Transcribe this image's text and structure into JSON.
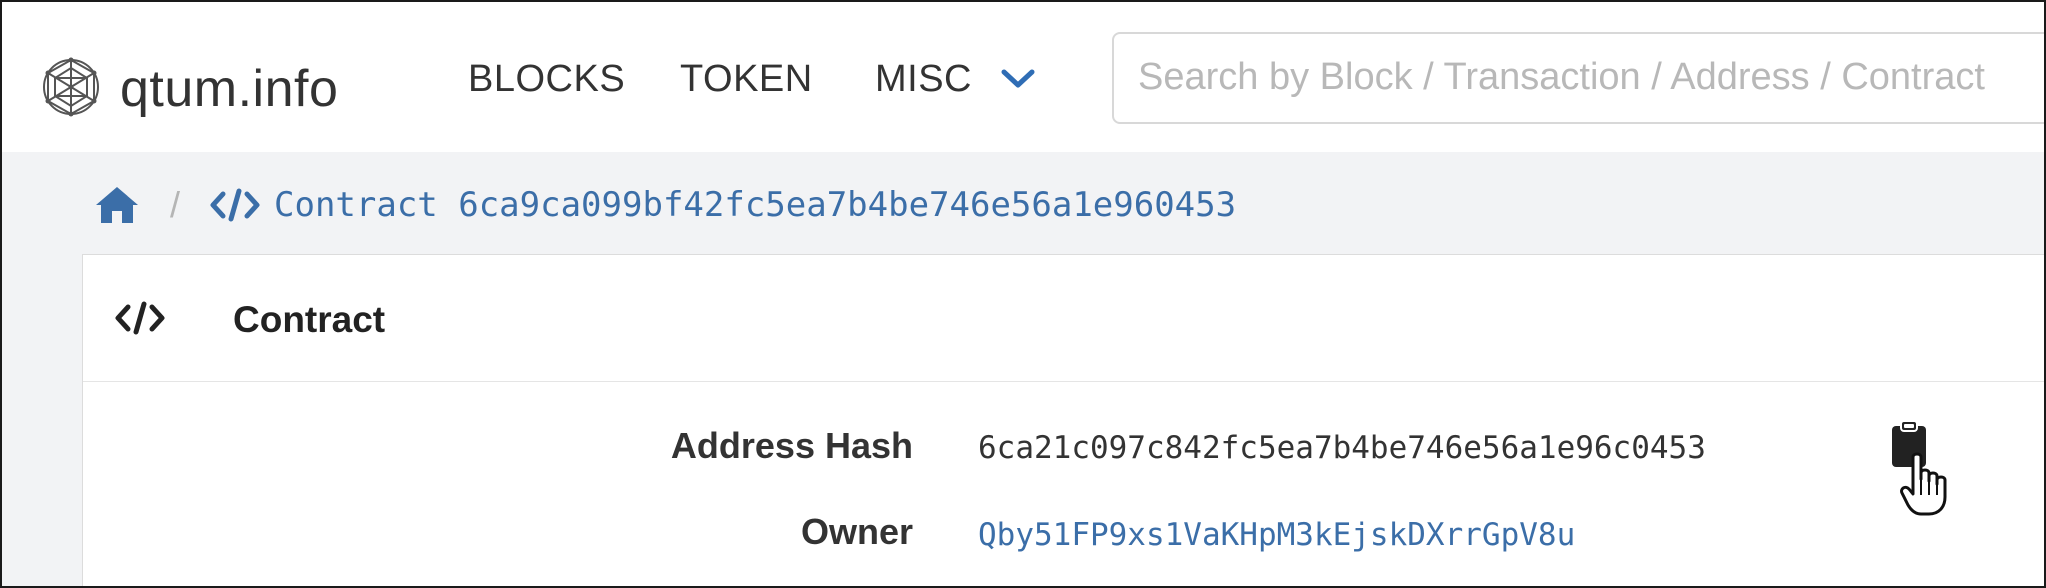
{
  "brand": {
    "name": "qtum.info",
    "logo_icon": "qtum-globe-icon"
  },
  "nav": {
    "blocks": "BLOCKS",
    "token": "TOKEN",
    "misc": "MISC",
    "misc_icon": "chevron-down-icon"
  },
  "search": {
    "placeholder": "Search by Block / Transaction / Address / Contract",
    "value": ""
  },
  "breadcrumb": {
    "home_icon": "home-icon",
    "separator": "/",
    "code_icon": "code-icon",
    "contract_label": "Contract 6ca9ca099bf42fc5ea7b4be746e56a1e960453"
  },
  "card": {
    "title": "Contract",
    "icon": "code-icon",
    "fields": {
      "address_hash_label": "Address Hash",
      "address_hash_value": "6ca21c097c842fc5ea7b4be746e56a1e96c0453",
      "owner_label": "Owner",
      "owner_value": "Qby51FP9xs1VaKHpM3kEjskDXrrGpV8u"
    },
    "copy_icon": "clipboard-icon",
    "cursor_icon": "hand-pointer-icon"
  },
  "colors": {
    "link": "#3b6ea8",
    "page_background": "#f2f3f5",
    "text": "#333333",
    "placeholder": "#b8b8b8"
  }
}
